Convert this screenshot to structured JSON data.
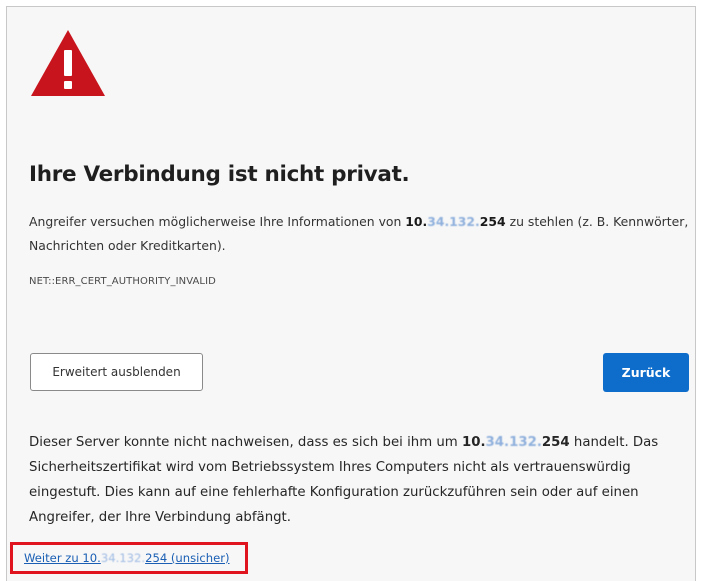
{
  "page": {
    "title": "Ihre Verbindung ist nicht privat.",
    "intro": {
      "text_before": "Angreifer versuchen möglicherweise Ihre Informationen von ",
      "host_prefix": "10.",
      "host_masked": "34.132.",
      "host_suffix": "254",
      "text_after": " zu stehlen (z. B. Kennwörter, Nachrichten oder Kreditkarten)."
    },
    "error_code": "NET::ERR_CERT_AUTHORITY_INVALID"
  },
  "buttons": {
    "advanced_label": "Erweitert ausblenden",
    "back_label": "Zurück"
  },
  "details": {
    "text_before": "Dieser Server konnte nicht nachweisen, dass es sich bei ihm um ",
    "host_prefix": "10.",
    "host_masked": "34.132.",
    "host_suffix": "254",
    "text_after": " handelt. Das Sicherheitszertifikat wird vom Betriebssystem Ihres Computers nicht als vertrauenswürdig eingestuft. Dies kann auf eine fehlerhafte Konfiguration zurückzuführen sein oder auf einen Angreifer, der Ihre Verbindung abfängt."
  },
  "proceed": {
    "text_before": "Weiter zu 10.",
    "host_masked": "34.132.",
    "text_after": "254 (unsicher)"
  },
  "colors": {
    "warning_red": "#c8141c",
    "primary_blue": "#0e6dca",
    "highlight_red": "#e0141f",
    "link_blue": "#1a5fb4"
  },
  "icons": {
    "warning": "warning-triangle-icon"
  }
}
